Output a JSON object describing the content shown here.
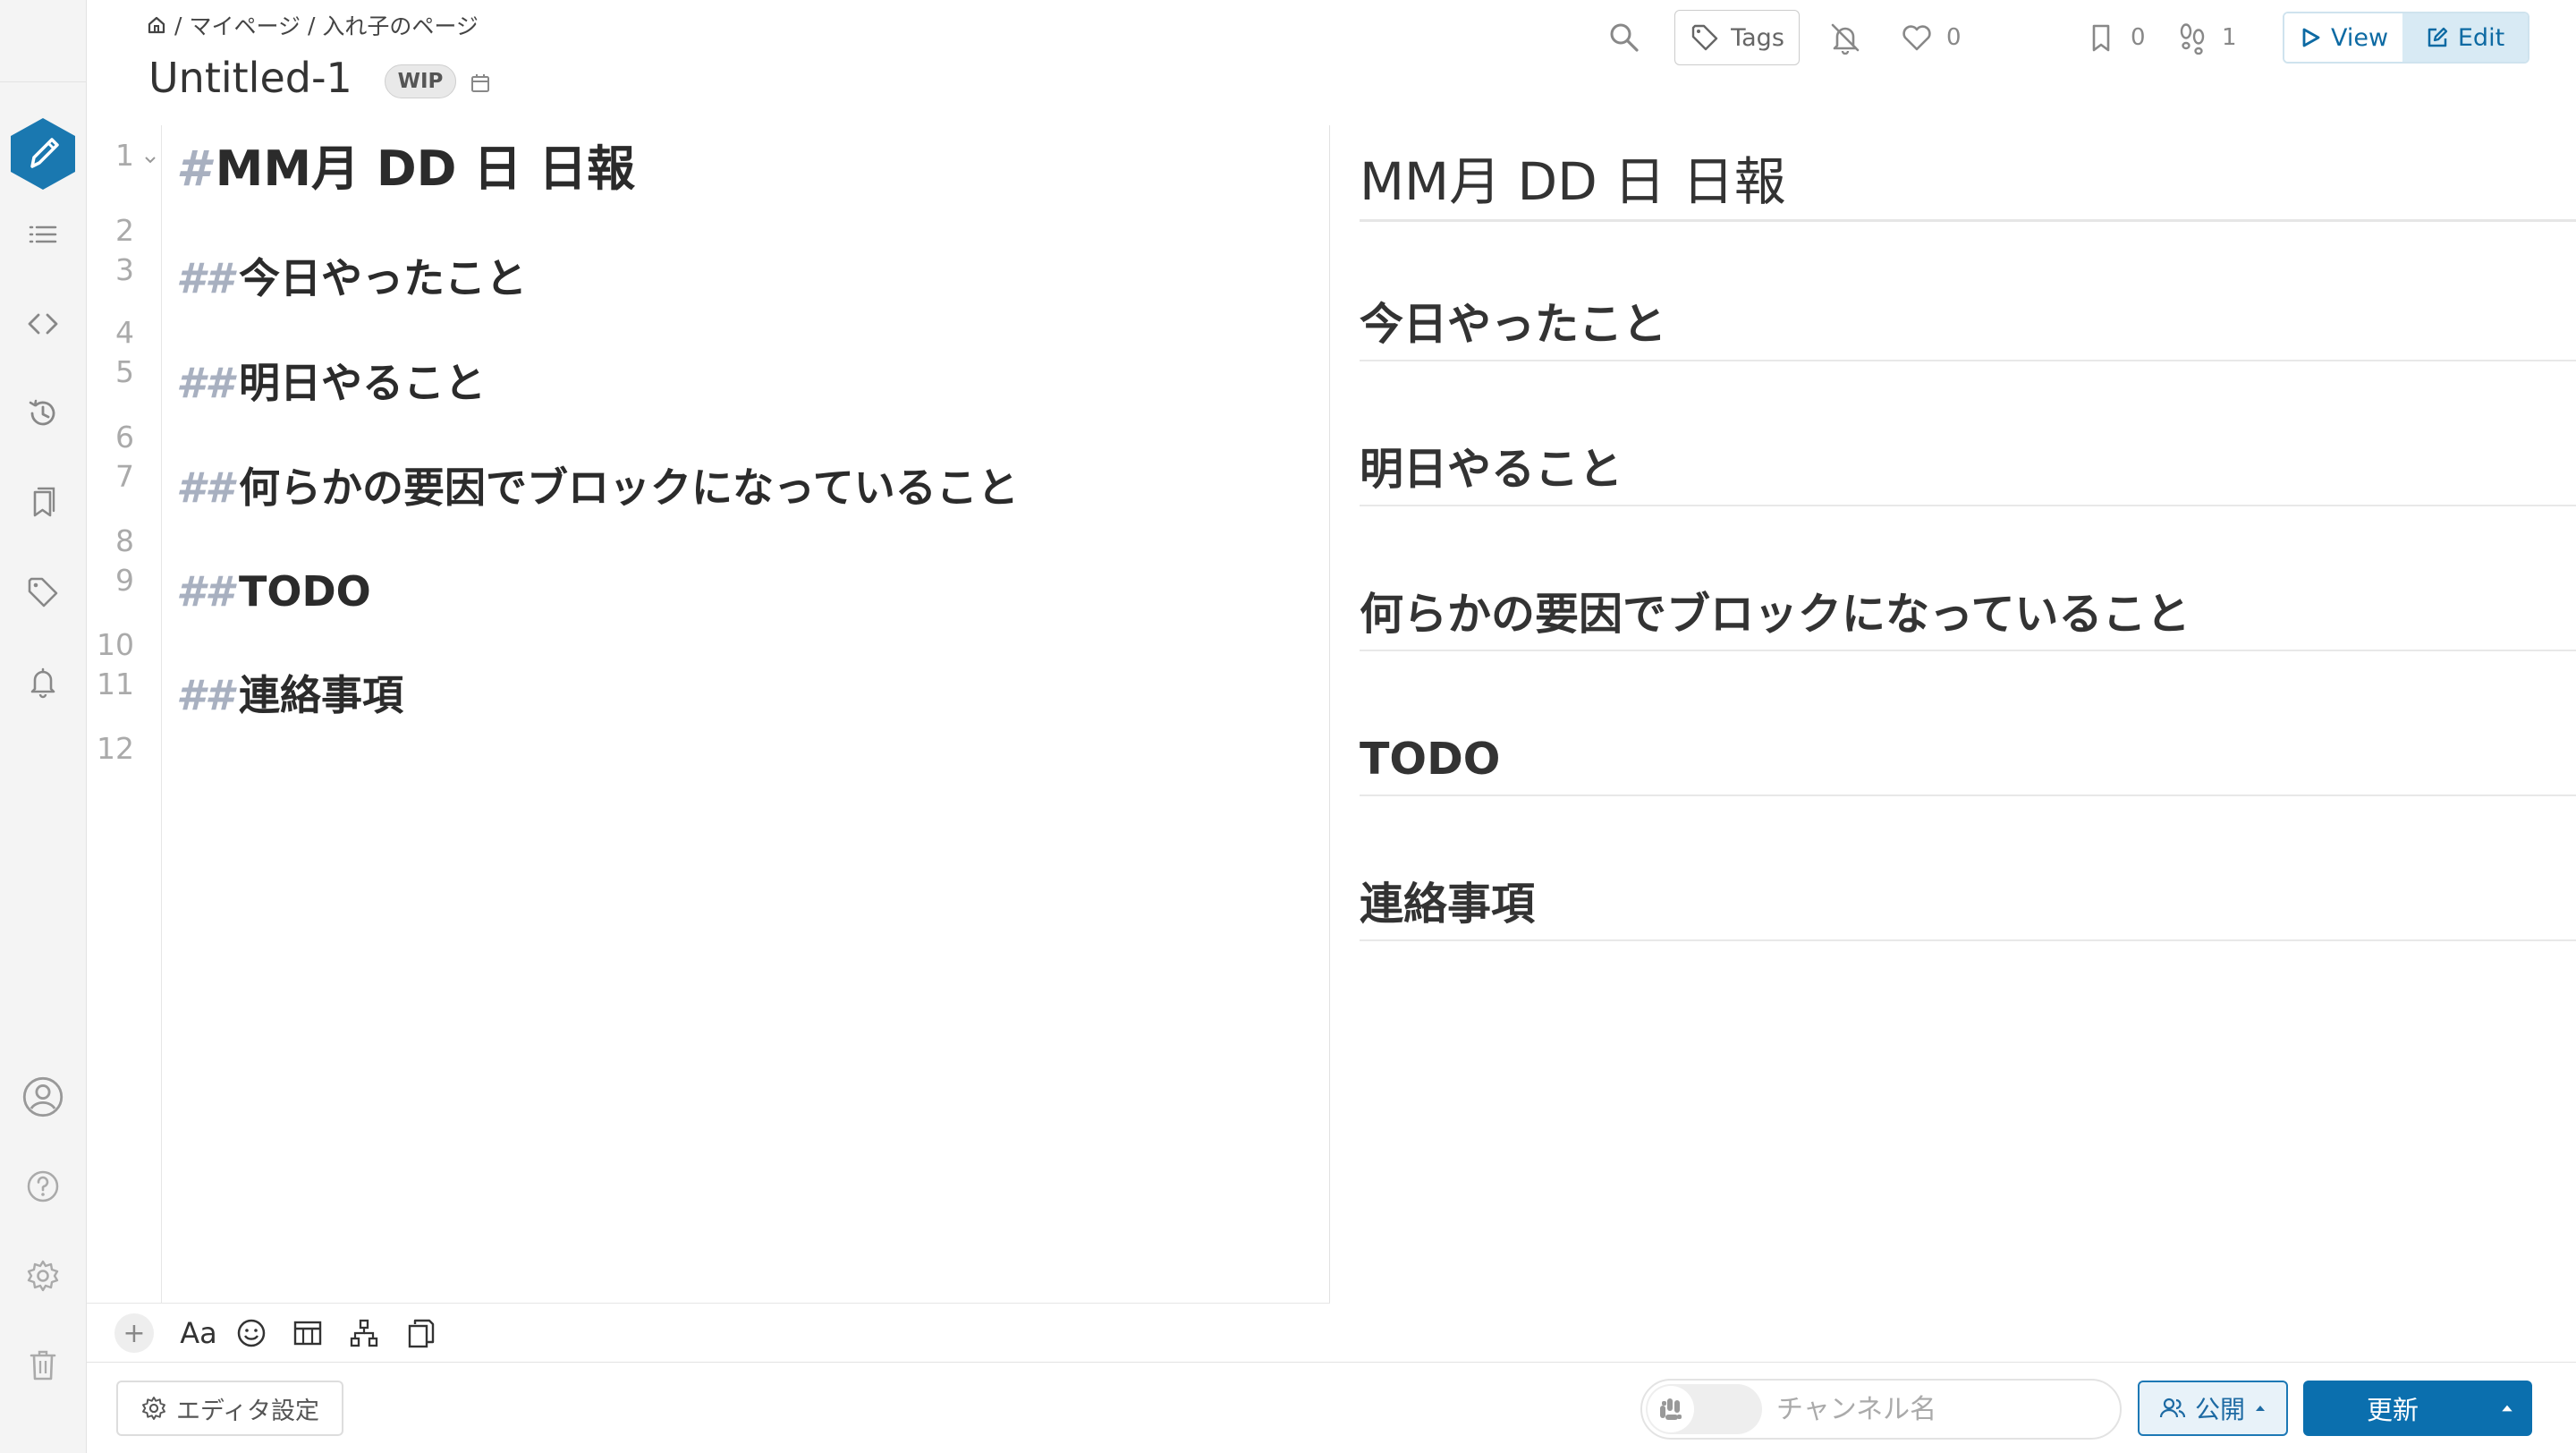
{
  "breadcrumb": {
    "items": [
      "/",
      "マイページ",
      "/",
      "入れ子のページ"
    ]
  },
  "page": {
    "title": "Untitled-1",
    "wip_label": "WIP"
  },
  "header_actions": {
    "tags_label": "Tags",
    "like_count": "0",
    "bookmark_count": "0",
    "seen_count": "1",
    "view_label": "View",
    "edit_label": "Edit"
  },
  "editor": {
    "line_numbers": [
      "1",
      "2",
      "3",
      "4",
      "5",
      "6",
      "7",
      "8",
      "9",
      "10",
      "11",
      "12"
    ],
    "lines": [
      {
        "mark": "#",
        "text": "MM月 DD 日 日報"
      },
      {
        "mark": "##",
        "text": "今日やったこと"
      },
      {
        "mark": "##",
        "text": "明日やること"
      },
      {
        "mark": "##",
        "text": "何らかの要因でブロックになっていること"
      },
      {
        "mark": "##",
        "text": "TODO"
      },
      {
        "mark": "##",
        "text": "連絡事項"
      }
    ],
    "toolbar": {
      "add_label": "+",
      "font_label": "Aa"
    }
  },
  "preview": {
    "h1": "MM月 DD 日 日報",
    "h2": [
      "今日やったこと",
      "明日やること",
      "何らかの要因でブロックになっていること",
      "TODO",
      "連絡事項"
    ]
  },
  "footer": {
    "editor_settings_label": "エディタ設定",
    "channel_placeholder": "チャンネル名",
    "grant_label": "公開",
    "update_label": "更新"
  },
  "colors": {
    "accent": "#1a78b0",
    "sidebar_bg": "#f4f4f4",
    "markdown_mark": "#a8b0c0"
  },
  "icons": {
    "sidebar": [
      "pencil-icon",
      "list-icon",
      "code-icon",
      "history-icon",
      "bookmarks-icon",
      "tag-icon",
      "bell-icon",
      "user-icon",
      "help-icon",
      "gear-icon",
      "trash-icon"
    ],
    "header": [
      "home-icon",
      "calendar-icon",
      "search-icon",
      "tag-icon",
      "bell-off-icon",
      "heart-icon",
      "bookmark-icon",
      "footprints-icon",
      "kebab-icon",
      "play-icon",
      "edit-icon",
      "avatar-icon"
    ],
    "editor_toolbar": [
      "plus-icon",
      "font-icon",
      "emoji-icon",
      "table-icon",
      "diagram-icon",
      "template-icon"
    ],
    "footer": [
      "gear-icon",
      "slack-icon",
      "users-icon",
      "caret-up-icon"
    ]
  }
}
